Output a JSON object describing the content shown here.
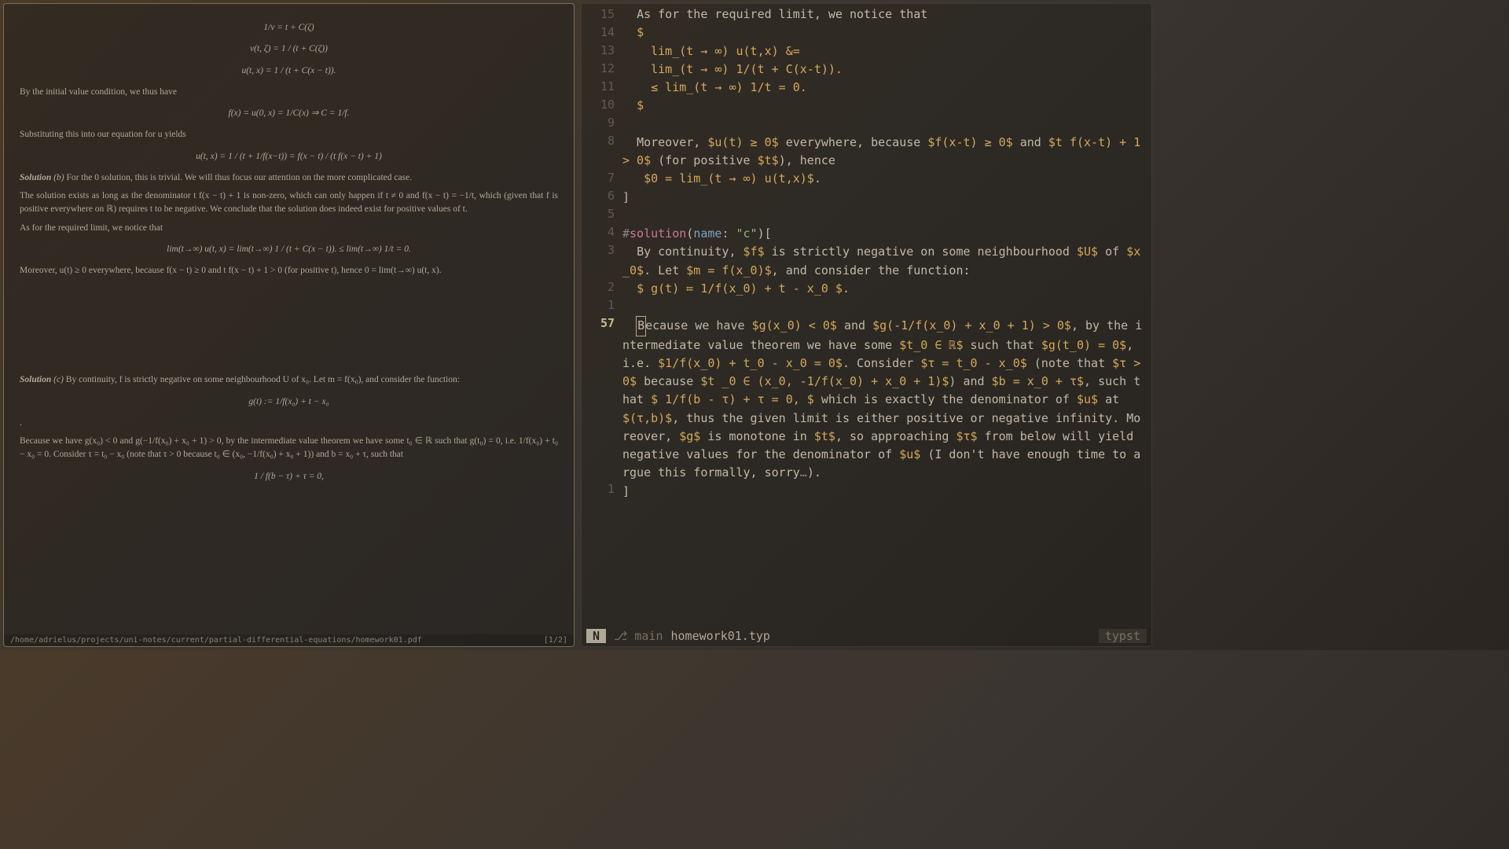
{
  "pdf": {
    "status_path": "/home/adrielus/projects/uni-notes/current/partial-differential-equations/homework01.pdf",
    "page_indicator": "[1/2]",
    "eq1": "1/v = t + C(ζ)",
    "eq2": "v(t, ζ) = 1 / (t + C(ζ))",
    "eq3": "u(t, x) = 1 / (t + C(x − t)).",
    "p1": "By the initial value condition, we thus have",
    "eq4": "f(x) = u(0, x) = 1/C(x) ⇒ C = 1/f.",
    "p2": "Substituting this into our equation for u yields",
    "eq5": "u(t, x) = 1 / (t + 1/f(x−t)) = f(x − t) / (t f(x − t) + 1)",
    "sol_b_head": "Solution",
    "sol_b_label": "(b)",
    "sol_b_text": "   For the 0 solution, this is trivial. We will thus focus our attention on the more complicated case.",
    "sol_b_p2": "      The solution exists as long as the denominator t f(x − t) + 1 is non-zero, which can only happen if t ≠ 0 and f(x − t) = −1/t, which (given that f is positive everywhere on ℝ) requires t to be negative. We conclude that the solution does indeed exist for positive values of t.",
    "sol_b_p3": "      As for the required limit, we notice that",
    "eq6": "lim(t→∞) u(t, x) = lim(t→∞) 1 / (t + C(x − t)). ≤ lim(t→∞) 1/t = 0.",
    "sol_b_p4": "Moreover, u(t) ≥ 0  everywhere,  because  f(x − t) ≥ 0  and  t f(x − t) + 1 > 0  (for  positive  t), hence 0 = lim(t→∞) u(t, x).",
    "sol_c_head": "Solution",
    "sol_c_label": "(c)",
    "sol_c_text": "   By continuity, f is strictly negative on some neighbourhood U of x₀. Let m = f(x₀), and consider the function:",
    "eq7": "g(t) := 1/f(x₀) + t − x₀",
    "dot": ".",
    "sol_c_p2": "      Because we have g(x₀) < 0 and g(−1/f(x₀) + x₀ + 1) > 0, by the intermediate value theorem we have some t₀ ∈ ℝ such that g(t₀) = 0, i.e. 1/f(x₀) + t₀ − x₀ = 0. Consider τ = t₀ − x₀ (note that τ > 0 because t₀ ∈ (x₀, −1/f(x₀) + x₀ + 1)) and b = x₀ + τ, such that",
    "eq8": "1 / f(b − τ) + τ = 0,"
  },
  "editor": {
    "mode": "N",
    "branch_icon": "⎇",
    "branch": "main",
    "filename": "homework01.typ",
    "filetype": "typst",
    "lines": [
      {
        "n": "15",
        "segs": [
          {
            "t": "  As for the required limit, we notice that",
            "c": ""
          }
        ]
      },
      {
        "n": "14",
        "segs": [
          {
            "t": "  ",
            "c": ""
          },
          {
            "t": "$",
            "c": "tok-math"
          }
        ]
      },
      {
        "n": "13",
        "segs": [
          {
            "t": "    ",
            "c": ""
          },
          {
            "t": "lim_(t → ∞) u(t,x) &=",
            "c": "tok-math"
          }
        ]
      },
      {
        "n": "12",
        "segs": [
          {
            "t": "    ",
            "c": ""
          },
          {
            "t": "lim_(t → ∞) 1/(t + C(x-t)).",
            "c": "tok-math"
          }
        ]
      },
      {
        "n": "11",
        "segs": [
          {
            "t": "    ",
            "c": ""
          },
          {
            "t": "≤ lim_(t → ∞) 1/t = 0.",
            "c": "tok-math"
          }
        ]
      },
      {
        "n": "10",
        "segs": [
          {
            "t": "  ",
            "c": ""
          },
          {
            "t": "$",
            "c": "tok-math"
          }
        ]
      },
      {
        "n": "9",
        "segs": [
          {
            "t": "",
            "c": ""
          }
        ]
      },
      {
        "n": "8",
        "segs": [
          {
            "t": "  Moreover, ",
            "c": ""
          },
          {
            "t": "$u(t) ≥ 0$",
            "c": "tok-math"
          },
          {
            "t": " everywhere, because ",
            "c": ""
          },
          {
            "t": "$f(x-t) ≥ 0$",
            "c": "tok-math"
          },
          {
            "t": " and ",
            "c": ""
          },
          {
            "t": "$t f(x-t) + 1 > 0$",
            "c": "tok-math"
          },
          {
            "t": " (for positive ",
            "c": ""
          },
          {
            "t": "$t$",
            "c": "tok-math"
          },
          {
            "t": "), hence",
            "c": ""
          }
        ]
      },
      {
        "n": "7",
        "segs": [
          {
            "t": "   ",
            "c": ""
          },
          {
            "t": "$0 = lim_(t → ∞) u(t,x)$",
            "c": "tok-math"
          },
          {
            "t": ".",
            "c": ""
          }
        ]
      },
      {
        "n": "6",
        "segs": [
          {
            "t": "]",
            "c": ""
          }
        ]
      },
      {
        "n": "5",
        "segs": [
          {
            "t": "",
            "c": ""
          }
        ]
      },
      {
        "n": "4",
        "segs": [
          {
            "t": "#",
            "c": "tok-op"
          },
          {
            "t": "solution",
            "c": "tok-fn"
          },
          {
            "t": "(",
            "c": ""
          },
          {
            "t": "name",
            "c": "tok-key"
          },
          {
            "t": ": ",
            "c": ""
          },
          {
            "t": "\"c\"",
            "c": "tok-str"
          },
          {
            "t": ")[",
            "c": ""
          }
        ]
      },
      {
        "n": "3",
        "segs": [
          {
            "t": "  By continuity, ",
            "c": ""
          },
          {
            "t": "$f$",
            "c": "tok-math"
          },
          {
            "t": " is strictly negative on some neighbourhood ",
            "c": ""
          },
          {
            "t": "$U$",
            "c": "tok-math"
          },
          {
            "t": " of ",
            "c": ""
          },
          {
            "t": "$x_0$",
            "c": "tok-math"
          },
          {
            "t": ". Let ",
            "c": ""
          },
          {
            "t": "$m = f(x_0)$",
            "c": "tok-math"
          },
          {
            "t": ", and consider the function:",
            "c": ""
          }
        ]
      },
      {
        "n": "2",
        "segs": [
          {
            "t": "  ",
            "c": ""
          },
          {
            "t": "$ g(t) ≔ 1/f(x_0) + t - x_0 $",
            "c": "tok-math"
          },
          {
            "t": ".",
            "c": ""
          }
        ]
      },
      {
        "n": "1",
        "segs": [
          {
            "t": "",
            "c": ""
          }
        ]
      },
      {
        "n": "57",
        "abs": true,
        "segs": [
          {
            "t": "  ",
            "c": ""
          },
          {
            "t": "B",
            "c": "tok-cursor"
          },
          {
            "t": "ecause we have ",
            "c": ""
          },
          {
            "t": "$g(x_0) < 0$",
            "c": "tok-math"
          },
          {
            "t": " and ",
            "c": ""
          },
          {
            "t": "$g(-1/f(x_0) + x_0 + 1) > 0$",
            "c": "tok-math"
          },
          {
            "t": ", by the intermediate value theorem we have some ",
            "c": ""
          },
          {
            "t": "$t_0 ∈ ℝ$",
            "c": "tok-math"
          },
          {
            "t": " such that ",
            "c": ""
          },
          {
            "t": "$g(t_0) = 0$",
            "c": "tok-math"
          },
          {
            "t": ", i.e. ",
            "c": ""
          },
          {
            "t": "$1/f(x_0) + t_0 - x_0 = 0$",
            "c": "tok-math"
          },
          {
            "t": ". Consider ",
            "c": ""
          },
          {
            "t": "$τ = t_0 - x_0$",
            "c": "tok-math"
          },
          {
            "t": " (note that ",
            "c": ""
          },
          {
            "t": "$τ > 0$",
            "c": "tok-math"
          },
          {
            "t": " because ",
            "c": ""
          },
          {
            "t": "$t _0 ∈ (x_0, -1/f(x_0) + x_0 + 1)$",
            "c": "tok-math"
          },
          {
            "t": ") and ",
            "c": ""
          },
          {
            "t": "$b = x_0 + τ$",
            "c": "tok-math"
          },
          {
            "t": ", such that ",
            "c": ""
          },
          {
            "t": "$ 1/f(b - τ) + τ = 0, $",
            "c": "tok-math"
          },
          {
            "t": " which is exactly the denominator of ",
            "c": ""
          },
          {
            "t": "$u$",
            "c": "tok-math"
          },
          {
            "t": " at ",
            "c": ""
          },
          {
            "t": "$(τ,b)$",
            "c": "tok-math"
          },
          {
            "t": ", thus the given limit is either positive or negative infinity. Moreover, ",
            "c": ""
          },
          {
            "t": "$g$",
            "c": "tok-math"
          },
          {
            "t": " is monotone in ",
            "c": ""
          },
          {
            "t": "$t$",
            "c": "tok-math"
          },
          {
            "t": ", so approaching ",
            "c": ""
          },
          {
            "t": "$τ$",
            "c": "tok-math"
          },
          {
            "t": " from below will yield negative values for the denominator of ",
            "c": ""
          },
          {
            "t": "$u$",
            "c": "tok-math"
          },
          {
            "t": " (I don't have enough time to argue this formally, sorry",
            "c": ""
          },
          {
            "t": "…",
            "c": "tok-op"
          },
          {
            "t": ").",
            "c": ""
          }
        ]
      },
      {
        "n": "1",
        "segs": [
          {
            "t": "]",
            "c": ""
          }
        ]
      }
    ]
  }
}
